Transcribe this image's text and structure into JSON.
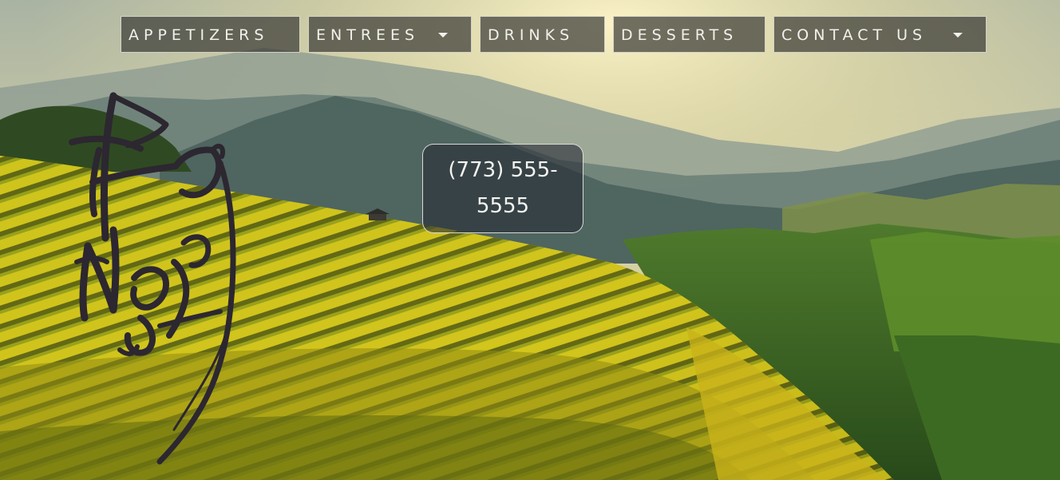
{
  "nav": {
    "items": [
      {
        "label": "APPETIZERS",
        "has_dropdown": false
      },
      {
        "label": "ENTREES",
        "has_dropdown": true
      },
      {
        "label": "DRINKS",
        "has_dropdown": false
      },
      {
        "label": "DESSERTS",
        "has_dropdown": false
      },
      {
        "label": "CONTACT US",
        "has_dropdown": true
      }
    ]
  },
  "phone": {
    "line1": "(773) 555-",
    "line2": "5555"
  },
  "logo": {
    "text": "Hồ Nội"
  },
  "colors": {
    "nav_bg": "#3c3c37",
    "nav_text": "#f1f1ec",
    "phone_bg": "#282d37",
    "logo_ink": "#2c2730"
  },
  "icons": {
    "dropdown": "caret-down-icon"
  }
}
